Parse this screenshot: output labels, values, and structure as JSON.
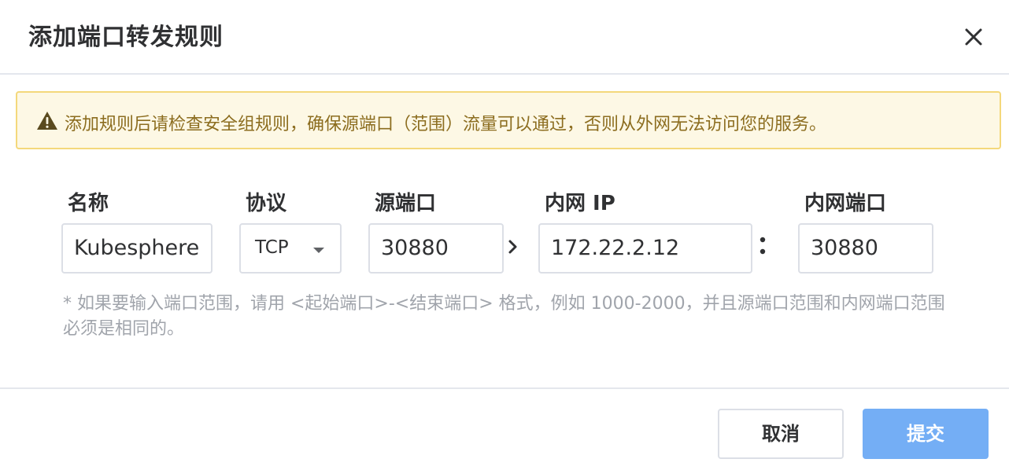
{
  "dialog": {
    "title": "添加端口转发规则",
    "close_icon": "close-icon"
  },
  "warning": {
    "icon": "warning-triangle-icon",
    "text": "添加规则后请检查安全组规则，确保源端口（范围）流量可以通过，否则从外网无法访问您的服务。",
    "colors": {
      "background": "#fdf8e5",
      "border": "#f4d87b",
      "text": "#8c6d1f",
      "icon": "#e6a23c"
    }
  },
  "form": {
    "name": {
      "label": "名称",
      "value": "Kubesphere"
    },
    "protocol": {
      "label": "协议",
      "value": "TCP",
      "icon": "chevron-down-icon"
    },
    "source_port": {
      "label": "源端口",
      "value": "30880"
    },
    "separator_arrow": "chevron-right-icon",
    "internal_ip": {
      "label": "内网 IP",
      "value": "172.22.2.12"
    },
    "separator_colon": "colon",
    "internal_port": {
      "label": "内网端口",
      "value": "30880"
    }
  },
  "hint": "* 如果要输入端口范围，请用 <起始端口>-<结束端口> 格式，例如 1000-2000，并且源端口范围和内网端口范围必须是相同的。",
  "footer": {
    "cancel_label": "取消",
    "submit_label": "提交",
    "submit_color": "#74aef5"
  }
}
